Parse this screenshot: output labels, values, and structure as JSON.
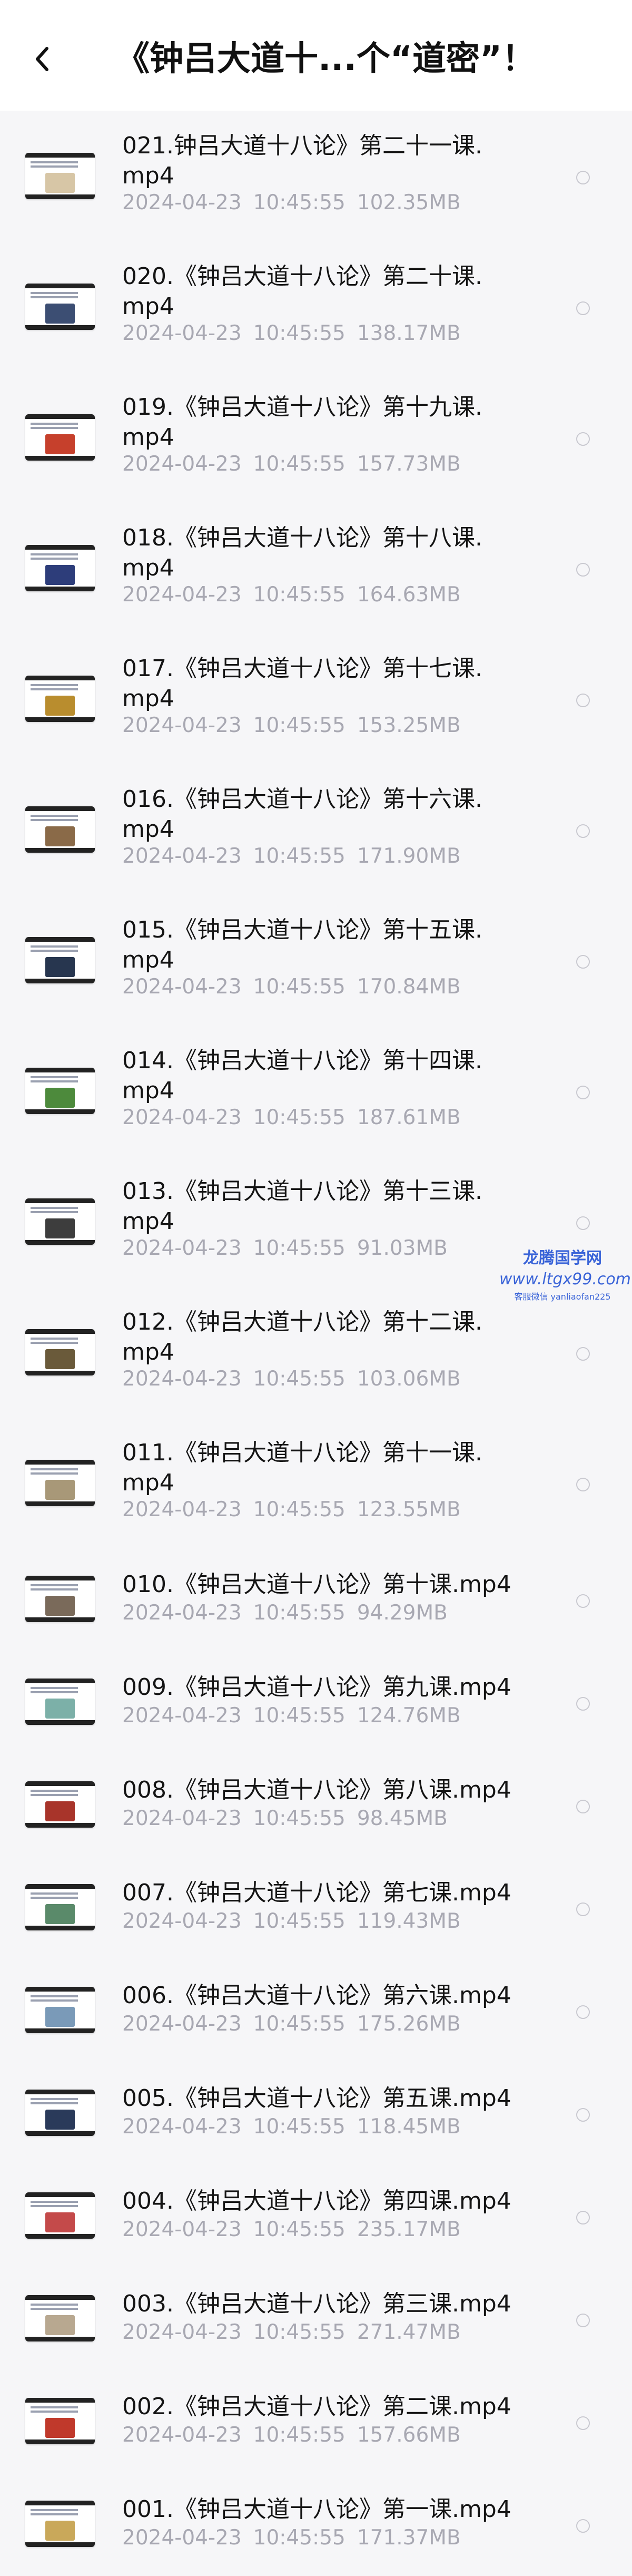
{
  "header": {
    "title": "《钟吕大道十...个“道密”！",
    "back_icon": "chevron-left-icon"
  },
  "files": [
    {
      "name": "021.钟吕大道十八论》第二十一课.mp4",
      "date": "2024-04-23",
      "time": "10:45:55",
      "size": "102.35MB",
      "thumb_color": "#d7c6a6"
    },
    {
      "name": "020.《钟吕大道十八论》第二十课.mp4",
      "date": "2024-04-23",
      "time": "10:45:55",
      "size": "138.17MB",
      "thumb_color": "#3c4e73"
    },
    {
      "name": "019.《钟吕大道十八论》第十九课.mp4",
      "date": "2024-04-23",
      "time": "10:45:55",
      "size": "157.73MB",
      "thumb_color": "#c6402c"
    },
    {
      "name": "018.《钟吕大道十八论》第十八课.mp4",
      "date": "2024-04-23",
      "time": "10:45:55",
      "size": "164.63MB",
      "thumb_color": "#2d3d7a"
    },
    {
      "name": "017.《钟吕大道十八论》第十七课.mp4",
      "date": "2024-04-23",
      "time": "10:45:55",
      "size": "153.25MB",
      "thumb_color": "#b98d2e"
    },
    {
      "name": "016.《钟吕大道十八论》第十六课.mp4",
      "date": "2024-04-23",
      "time": "10:45:55",
      "size": "171.90MB",
      "thumb_color": "#8a6a48"
    },
    {
      "name": "015.《钟吕大道十八论》第十五课.mp4",
      "date": "2024-04-23",
      "time": "10:45:55",
      "size": "170.84MB",
      "thumb_color": "#27364f"
    },
    {
      "name": "014.《钟吕大道十八论》第十四课.mp4",
      "date": "2024-04-23",
      "time": "10:45:55",
      "size": "187.61MB",
      "thumb_color": "#4d8a3c"
    },
    {
      "name": "013.《钟吕大道十八论》第十三课.mp4",
      "date": "2024-04-23",
      "time": "10:45:55",
      "size": "91.03MB",
      "thumb_color": "#3d3d3d"
    },
    {
      "name": "012.《钟吕大道十八论》第十二课.mp4",
      "date": "2024-04-23",
      "time": "10:45:55",
      "size": "103.06MB",
      "thumb_color": "#6a5a3a"
    },
    {
      "name": "011.《钟吕大道十八论》第十一课.mp4",
      "date": "2024-04-23",
      "time": "10:45:55",
      "size": "123.55MB",
      "thumb_color": "#a89878"
    },
    {
      "name": "010.《钟吕大道十八论》第十课.mp4",
      "date": "2024-04-23",
      "time": "10:45:55",
      "size": "94.29MB",
      "thumb_color": "#7a6a5a"
    },
    {
      "name": "009.《钟吕大道十八论》第九课.mp4",
      "date": "2024-04-23",
      "time": "10:45:55",
      "size": "124.76MB",
      "thumb_color": "#7cb0a8"
    },
    {
      "name": "008.《钟吕大道十八论》第八课.mp4",
      "date": "2024-04-23",
      "time": "10:45:55",
      "size": "98.45MB",
      "thumb_color": "#a8342a"
    },
    {
      "name": "007.《钟吕大道十八论》第七课.mp4",
      "date": "2024-04-23",
      "time": "10:45:55",
      "size": "119.43MB",
      "thumb_color": "#5a8a6a"
    },
    {
      "name": "006.《钟吕大道十八论》第六课.mp4",
      "date": "2024-04-23",
      "time": "10:45:55",
      "size": "175.26MB",
      "thumb_color": "#7a9ab8"
    },
    {
      "name": "005.《钟吕大道十八论》第五课.mp4",
      "date": "2024-04-23",
      "time": "10:45:55",
      "size": "118.45MB",
      "thumb_color": "#2a3a5a"
    },
    {
      "name": "004.《钟吕大道十八论》第四课.mp4",
      "date": "2024-04-23",
      "time": "10:45:55",
      "size": "235.17MB",
      "thumb_color": "#c44a4a"
    },
    {
      "name": "003.《钟吕大道十八论》第三课.mp4",
      "date": "2024-04-23",
      "time": "10:45:55",
      "size": "271.47MB",
      "thumb_color": "#b8a890"
    },
    {
      "name": "002.《钟吕大道十八论》第二课.mp4",
      "date": "2024-04-23",
      "time": "10:45:55",
      "size": "157.66MB",
      "thumb_color": "#c0392b"
    },
    {
      "name": "001.《钟吕大道十八论》第一课.mp4",
      "date": "2024-04-23",
      "time": "10:45:55",
      "size": "171.37MB",
      "thumb_color": "#c9a85a"
    }
  ],
  "watermark": {
    "line1": "龙腾国学网",
    "line2": "www.ltgx99.com",
    "line3": "客服微信 yanliaofan225"
  }
}
